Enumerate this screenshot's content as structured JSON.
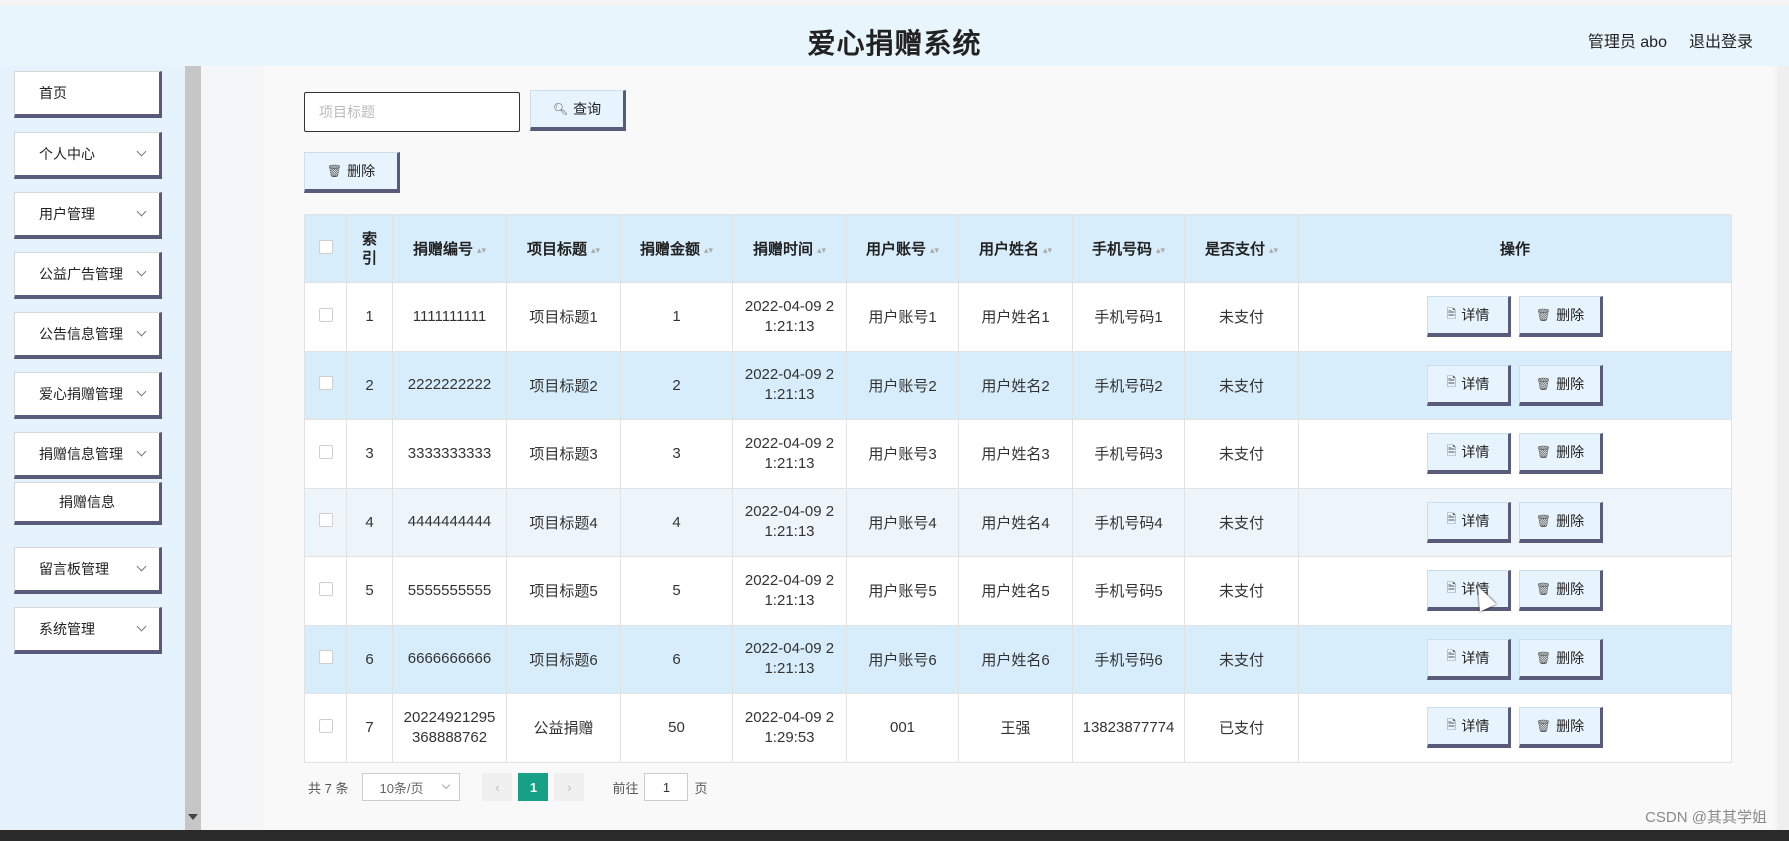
{
  "header": {
    "title": "爱心捐赠系统",
    "admin_label": "管理员 abo",
    "logout_label": "退出登录"
  },
  "sidebar": {
    "items": [
      {
        "label": "首页",
        "has_sub": false
      },
      {
        "label": "个人中心",
        "has_sub": true
      },
      {
        "label": "用户管理",
        "has_sub": true
      },
      {
        "label": "公益广告管理",
        "has_sub": true
      },
      {
        "label": "公告信息管理",
        "has_sub": true
      },
      {
        "label": "爱心捐赠管理",
        "has_sub": true
      },
      {
        "label": "捐赠信息管理",
        "has_sub": true
      },
      {
        "label": "捐赠信息",
        "has_sub": false,
        "is_sub": true
      },
      {
        "label": "留言板管理",
        "has_sub": true
      },
      {
        "label": "系统管理",
        "has_sub": true
      }
    ]
  },
  "search": {
    "placeholder": "项目标题",
    "button_label": "查询",
    "button_icon": "search-icon"
  },
  "toolbar": {
    "delete_label": "删除",
    "delete_icon": "trash-icon"
  },
  "table": {
    "columns": [
      "索引",
      "捐赠编号",
      "项目标题",
      "捐赠金额",
      "捐赠时间",
      "用户账号",
      "用户姓名",
      "手机号码",
      "是否支付",
      "操作"
    ],
    "rows": [
      {
        "index": "1",
        "donation_no": "1111111111",
        "project": "项目标题1",
        "amount": "1",
        "time": "2022-04-09 21:21:13",
        "account": "用户账号1",
        "name": "用户姓名1",
        "phone": "手机号码1",
        "paid": "未支付"
      },
      {
        "index": "2",
        "donation_no": "2222222222",
        "project": "项目标题2",
        "amount": "2",
        "time": "2022-04-09 21:21:13",
        "account": "用户账号2",
        "name": "用户姓名2",
        "phone": "手机号码2",
        "paid": "未支付"
      },
      {
        "index": "3",
        "donation_no": "3333333333",
        "project": "项目标题3",
        "amount": "3",
        "time": "2022-04-09 21:21:13",
        "account": "用户账号3",
        "name": "用户姓名3",
        "phone": "手机号码3",
        "paid": "未支付"
      },
      {
        "index": "4",
        "donation_no": "4444444444",
        "project": "项目标题4",
        "amount": "4",
        "time": "2022-04-09 21:21:13",
        "account": "用户账号4",
        "name": "用户姓名4",
        "phone": "手机号码4",
        "paid": "未支付"
      },
      {
        "index": "5",
        "donation_no": "5555555555",
        "project": "项目标题5",
        "amount": "5",
        "time": "2022-04-09 21:21:13",
        "account": "用户账号5",
        "name": "用户姓名5",
        "phone": "手机号码5",
        "paid": "未支付"
      },
      {
        "index": "6",
        "donation_no": "6666666666",
        "project": "项目标题6",
        "amount": "6",
        "time": "2022-04-09 21:21:13",
        "account": "用户账号6",
        "name": "用户姓名6",
        "phone": "手机号码6",
        "paid": "未支付"
      },
      {
        "index": "7",
        "donation_no": "20224921295368888762",
        "project": "公益捐赠",
        "amount": "50",
        "time": "2022-04-09 21:29:53",
        "account": "001",
        "name": "王强",
        "phone": "13823877774",
        "paid": "已支付"
      }
    ],
    "row_actions": {
      "detail_label": "详情",
      "detail_icon": "document-icon",
      "delete_label": "删除",
      "delete_icon": "trash-icon"
    }
  },
  "pagination": {
    "total_text": "共 7 条",
    "page_size": "10条/页",
    "current_page": "1",
    "goto_prefix": "前往",
    "goto_value": "1",
    "goto_suffix": "页"
  },
  "watermark": "CSDN @其其学姐",
  "colors": {
    "header_bg": "#e9f5fd",
    "table_header_bg": "#d7edfb",
    "page_active": "#16a085",
    "button_shadow": "#5a5a7a"
  }
}
